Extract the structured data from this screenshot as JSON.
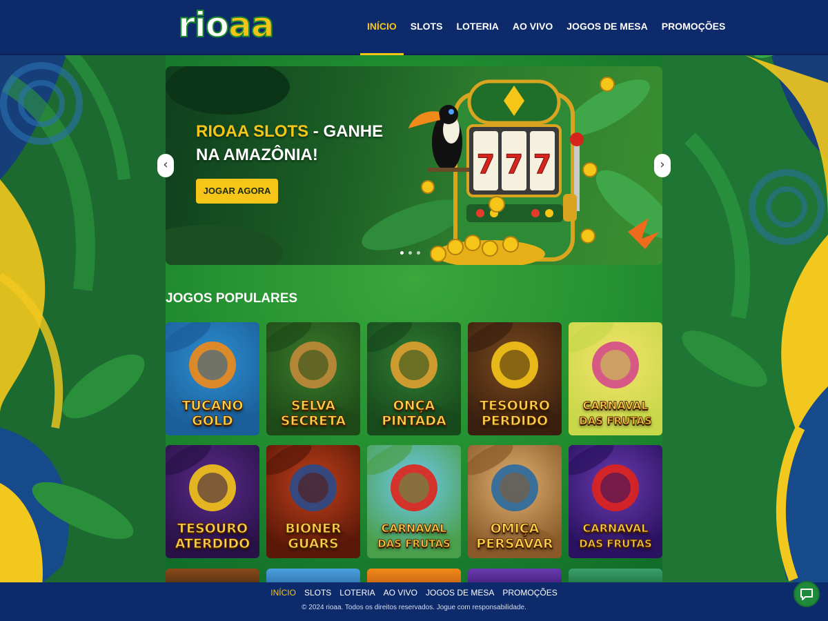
{
  "header": {
    "logo": {
      "part1": "rio",
      "part2": "aa"
    },
    "nav": [
      {
        "label": "INÍCIO",
        "active": true
      },
      {
        "label": "SLOTS",
        "active": false
      },
      {
        "label": "LOTERIA",
        "active": false
      },
      {
        "label": "AO VIVO",
        "active": false
      },
      {
        "label": "JOGOS DE MESA",
        "active": false
      },
      {
        "label": "PROMOÇÕES",
        "active": false
      }
    ]
  },
  "hero": {
    "title_brand": "RIOAA SLOTS",
    "title_rest": " - GANHE NA AMAZÔNIA!",
    "cta": "JOGAR AGORA",
    "slot_reels": [
      "7",
      "7",
      "7"
    ],
    "slides": 3,
    "active_slide": 0
  },
  "popular": {
    "title": "JOGOS POPULARES",
    "games": [
      {
        "line1": "TUCANO",
        "line2": "GOLD",
        "theme": "toucan"
      },
      {
        "line1": "SELVA",
        "line2": "SECRETA",
        "theme": "jungle"
      },
      {
        "line1": "ONÇA",
        "line2": "PINTADA",
        "theme": "jaguar"
      },
      {
        "line1": "TESOURO",
        "line2": "PERDIDO",
        "theme": "treasure"
      },
      {
        "line1": "CARNAVAL",
        "line2": "DAS FRUTAS",
        "theme": "fruits"
      },
      {
        "line1": "TESOURO",
        "line2": "ATERDIDO",
        "theme": "wheel"
      },
      {
        "line1": "BIONER",
        "line2": "GUARS",
        "theme": "warrior"
      },
      {
        "line1": "CARNAVAL",
        "line2": "DAS FRUTAS",
        "theme": "seven"
      },
      {
        "line1": "OMIÇA",
        "line2": "PERSAVAR",
        "theme": "hero"
      },
      {
        "line1": "CARNAVAL",
        "line2": "DAS FRUTAS",
        "theme": "sevenpurple"
      }
    ]
  },
  "footer": {
    "nav": [
      {
        "label": "INÍCIO",
        "active": true
      },
      {
        "label": "SLOTS",
        "active": false
      },
      {
        "label": "LOTERIA",
        "active": false
      },
      {
        "label": "AO VIVO",
        "active": false
      },
      {
        "label": "JOGOS DE MESA",
        "active": false
      },
      {
        "label": "PROMOÇÕES",
        "active": false
      }
    ],
    "copyright": "© 2024 rioaa. Todos os direitos reservados. Jogue com responsabilidade."
  },
  "icons": {
    "chat": "chat-bubble-icon",
    "prev": "chevron-left-icon",
    "next": "chevron-right-icon"
  },
  "colors": {
    "header_bg": "#0d2a6b",
    "accent": "#f5c518",
    "page_green": "#1f8a2e"
  }
}
